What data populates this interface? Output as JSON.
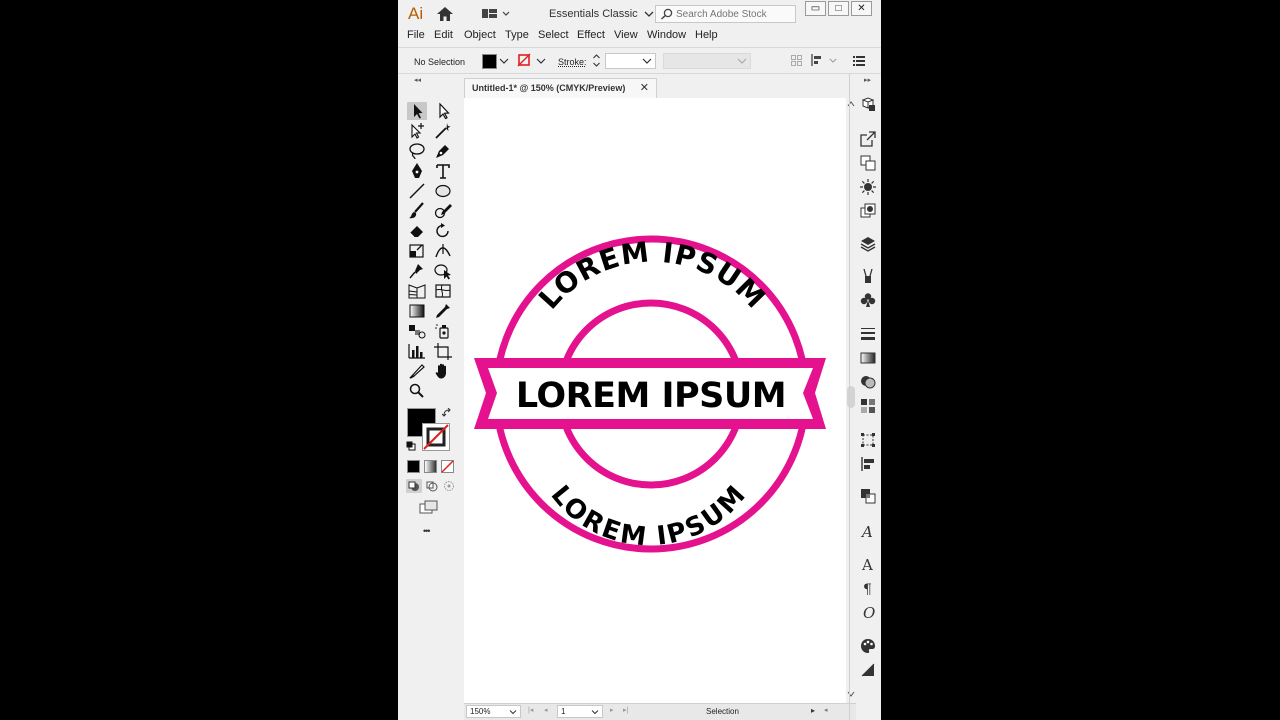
{
  "app": {
    "logo": "Ai",
    "workspace": "Essentials Classic",
    "search_placeholder": "Search Adobe Stock",
    "window_buttons": {
      "minimize": "▭",
      "restore": "□",
      "close": "✕"
    }
  },
  "menu": [
    "File",
    "Edit",
    "Object",
    "Type",
    "Select",
    "Effect",
    "View",
    "Window",
    "Help"
  ],
  "control_bar": {
    "selection_label": "No Selection",
    "stroke_label": "Stroke:"
  },
  "document": {
    "tab_title": "Untitled-1* @ 150% (CMYK/Preview)",
    "close_glyph": "✕"
  },
  "artwork": {
    "top_text": "LOREM IPSUM",
    "ribbon_text": "LOREM IPSUM",
    "bottom_text": "LOREM IPSUM",
    "accent_color": "#e4128f",
    "text_color": "#000000"
  },
  "status": {
    "zoom": "150%",
    "artboard": "1",
    "tool": "Selection"
  },
  "more_tools_glyph": "•••"
}
